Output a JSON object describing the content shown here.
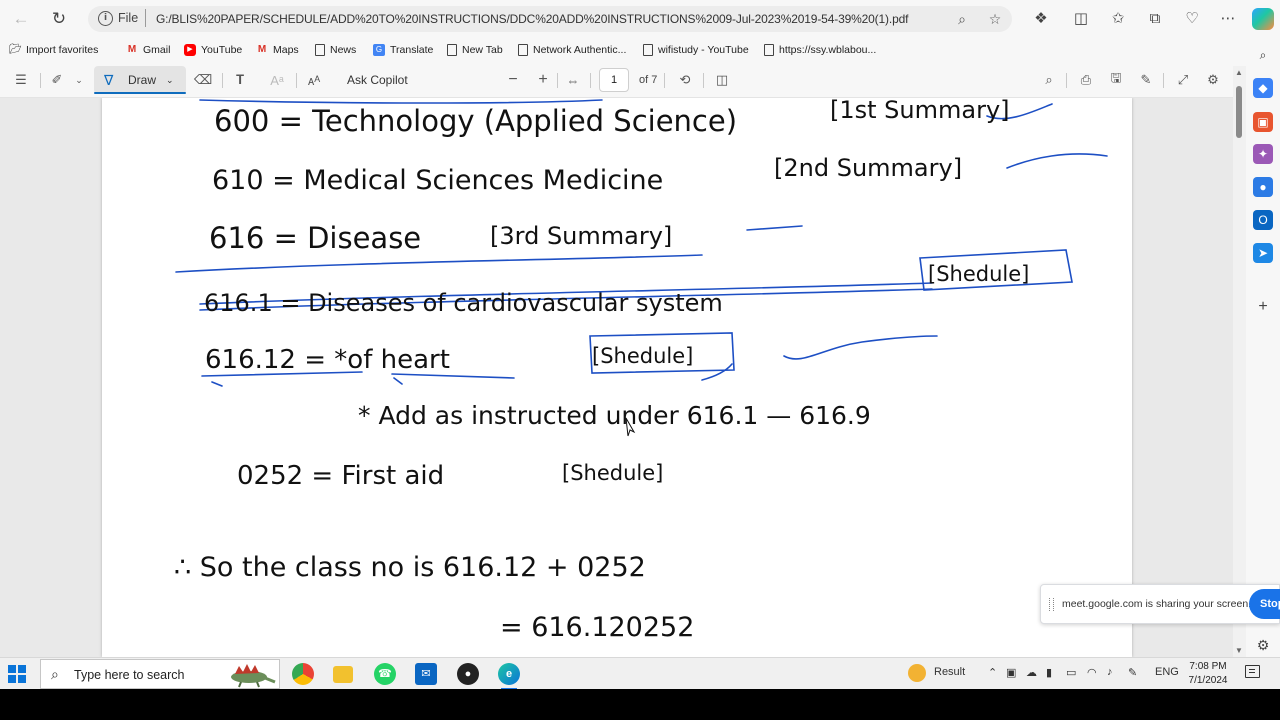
{
  "browser": {
    "url_scheme_label": "File",
    "url": "G:/BLIS%20PAPER/SCHEDULE/ADD%20TO%20INSTRUCTIONS/DDC%20ADD%20INSTRUCTIONS%2009-Jul-2023%2019-54-39%20(1).pdf"
  },
  "favorites": [
    {
      "label": "Import favorites",
      "icon": "folder-import-icon"
    },
    {
      "label": "Gmail",
      "icon": "gmail-icon"
    },
    {
      "label": "YouTube",
      "icon": "youtube-icon"
    },
    {
      "label": "Maps",
      "icon": "gmail-icon"
    },
    {
      "label": "News",
      "icon": "page-icon"
    },
    {
      "label": "Translate",
      "icon": "translate-icon"
    },
    {
      "label": "New Tab",
      "icon": "page-icon"
    },
    {
      "label": "Network Authentic...",
      "icon": "page-icon"
    },
    {
      "label": "wifistudy - YouTube",
      "icon": "page-icon"
    },
    {
      "label": "https://ssy.wblabou...",
      "icon": "page-icon"
    }
  ],
  "pdf_toolbar": {
    "draw_label": "Draw",
    "ask_copilot_label": "Ask Copilot",
    "current_page": "1",
    "page_count": "of 7"
  },
  "pdf_content": {
    "line1": {
      "left": "600 = Technology (Applied Science)",
      "tag": "[1st Summary]"
    },
    "line2": {
      "left": "610 = Medical Sciences Medicine",
      "tag": "[2nd Summary]"
    },
    "line3": {
      "left": "616 = Disease",
      "tag": "[3rd Summary]"
    },
    "line4": {
      "left": "616.1 = Diseases of cardiovascular system",
      "tag": "[Shedule]"
    },
    "line5": {
      "left": "616.12 = *of heart",
      "tag": "[Shedule]"
    },
    "line6": {
      "text": "* Add as instructed under 616.1 — 616.9"
    },
    "line7": {
      "left": "0252 = First aid",
      "tag": "[Shedule]"
    },
    "line8": {
      "text": "∴ So the class no is 616.12 + 0252"
    },
    "line9": {
      "text": "= 616.120252"
    }
  },
  "share_banner": {
    "message": "meet.google.com is sharing your screen.",
    "stop_label": "Stop"
  },
  "taskbar": {
    "search_placeholder": "Type here to search",
    "weather_label": "Result",
    "language": "ENG",
    "time": "7:08 PM",
    "date": "7/1/2024"
  },
  "colors": {
    "accent": "#0f6cbd",
    "ink": "#111111",
    "annotation_blue": "#1d4fc4",
    "share_stop": "#1a73e8"
  }
}
